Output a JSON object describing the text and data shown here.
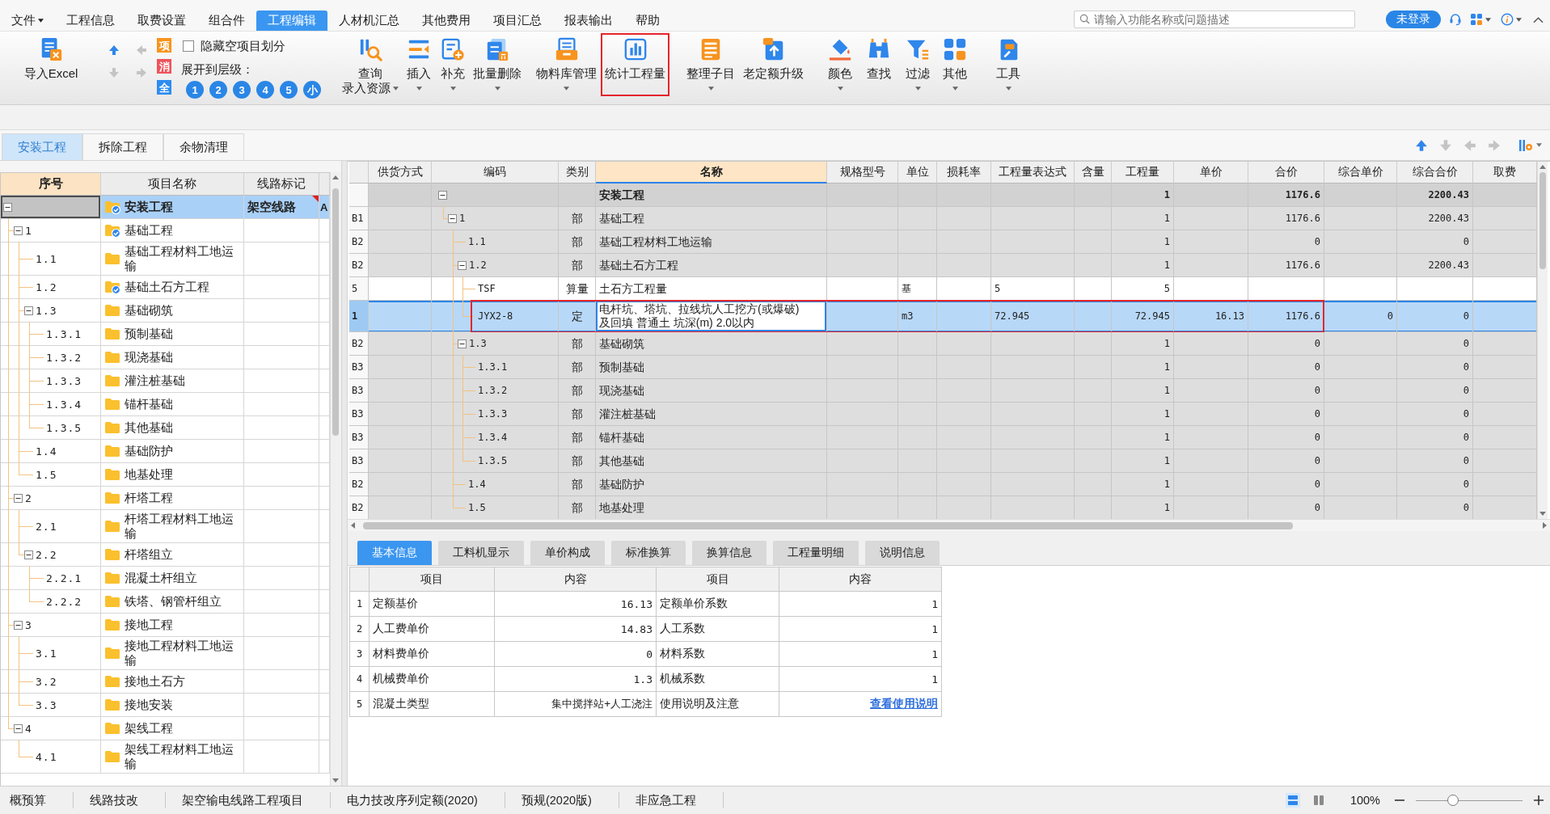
{
  "menu": {
    "items": [
      {
        "label": "文件",
        "dropdown": true,
        "selected": false
      },
      {
        "label": "工程信息",
        "dropdown": false,
        "selected": false
      },
      {
        "label": "取费设置",
        "dropdown": false,
        "selected": false
      },
      {
        "label": "组合件",
        "dropdown": false,
        "selected": false
      },
      {
        "label": "工程编辑",
        "dropdown": false,
        "selected": true
      },
      {
        "label": "人材机汇总",
        "dropdown": false,
        "selected": false
      },
      {
        "label": "其他费用",
        "dropdown": false,
        "selected": false
      },
      {
        "label": "项目汇总",
        "dropdown": false,
        "selected": false
      },
      {
        "label": "报表输出",
        "dropdown": false,
        "selected": false
      },
      {
        "label": "帮助",
        "dropdown": false,
        "selected": false
      }
    ]
  },
  "search": {
    "placeholder": "请输入功能名称或问题描述"
  },
  "account": {
    "label": "未登录"
  },
  "toolbar": {
    "import": {
      "label": "导入Excel"
    },
    "move_buttons": [
      {
        "disabled": false
      },
      {
        "disabled": true
      },
      {
        "disabled": true
      },
      {
        "disabled": true
      }
    ],
    "tiles": [
      {
        "label": "项",
        "color": "#f7941d"
      },
      {
        "label": "消",
        "color": "#f0525a"
      },
      {
        "label": "全",
        "color": "#2d8cf0"
      }
    ],
    "hide_empty": {
      "label": "隐藏空项目划分",
      "checked": false
    },
    "expand_levels": {
      "label": "展开到层级：",
      "options": [
        "1",
        "2",
        "3",
        "4",
        "5",
        "小"
      ]
    },
    "buttons": [
      {
        "label": "查询",
        "sublabel": "录入资源",
        "dropdown": true,
        "highlighted": false
      },
      {
        "label": "插入",
        "dropdown": true,
        "highlighted": false
      },
      {
        "label": "补充",
        "dropdown": true,
        "highlighted": false
      },
      {
        "label": "批量删除",
        "dropdown": true,
        "highlighted": false
      },
      {
        "label": "物料库管理",
        "dropdown": true,
        "highlighted": false
      },
      {
        "label": "统计工程量",
        "dropdown": false,
        "highlighted": true
      },
      {
        "label": "整理子目",
        "dropdown": true,
        "highlighted": false
      },
      {
        "label": "老定额升级",
        "dropdown": false,
        "highlighted": false
      },
      {
        "label": "颜色",
        "dropdown": true,
        "highlighted": false
      },
      {
        "label": "查找",
        "dropdown": false,
        "highlighted": false
      },
      {
        "label": "过滤",
        "dropdown": true,
        "highlighted": false
      },
      {
        "label": "其他",
        "dropdown": true,
        "highlighted": false
      },
      {
        "label": "工具",
        "dropdown": true,
        "highlighted": false
      }
    ]
  },
  "project_tabs": [
    {
      "label": "安装工程",
      "selected": true
    },
    {
      "label": "拆除工程",
      "selected": false
    },
    {
      "label": "余物清理",
      "selected": false
    }
  ],
  "table_nav": [
    {
      "disabled": false
    },
    {
      "disabled": true
    },
    {
      "disabled": true
    },
    {
      "disabled": true
    }
  ],
  "tree": {
    "columns": [
      {
        "label": "序号",
        "selected": true
      },
      {
        "label": "项目名称",
        "selected": false
      },
      {
        "label": "线路标记",
        "selected": false
      }
    ],
    "rows": [
      {
        "name": "安装工程",
        "route": "架空线路",
        "column_4": "A",
        "checked": true,
        "note": true,
        "selected": true,
        "expanded": true,
        "children": [
          {
            "number": "1",
            "name": "基础工程",
            "checked": true,
            "note": false,
            "selected": false,
            "expanded": true,
            "children": [
              {
                "number": "1.1",
                "name": "基础工程材料工地运输",
                "checked": false,
                "note": false,
                "selected": false
              },
              {
                "number": "1.2",
                "name": "基础土石方工程",
                "checked": true,
                "note": false,
                "selected": false
              },
              {
                "number": "1.3",
                "name": "基础砌筑",
                "checked": false,
                "note": false,
                "selected": false,
                "expanded": true,
                "children": [
                  {
                    "number": "1.3.1",
                    "name": "预制基础",
                    "checked": false,
                    "note": false,
                    "selected": false
                  },
                  {
                    "number": "1.3.2",
                    "name": "现浇基础",
                    "checked": false,
                    "note": false,
                    "selected": false
                  },
                  {
                    "number": "1.3.3",
                    "name": "灌注桩基础",
                    "checked": false,
                    "note": false,
                    "selected": false
                  },
                  {
                    "number": "1.3.4",
                    "name": "锚杆基础",
                    "checked": false,
                    "note": false,
                    "selected": false
                  },
                  {
                    "number": "1.3.5",
                    "name": "其他基础",
                    "checked": false,
                    "note": false,
                    "selected": false
                  }
                ]
              },
              {
                "number": "1.4",
                "name": "基础防护",
                "checked": false,
                "note": false,
                "selected": false
              },
              {
                "number": "1.5",
                "name": "地基处理",
                "checked": false,
                "note": false,
                "selected": false
              }
            ]
          },
          {
            "number": "2",
            "name": "杆塔工程",
            "checked": false,
            "note": false,
            "selected": false,
            "expanded": true,
            "children": [
              {
                "number": "2.1",
                "name": "杆塔工程材料工地运输",
                "checked": false,
                "note": false,
                "selected": false
              },
              {
                "number": "2.2",
                "name": "杆塔组立",
                "checked": false,
                "note": false,
                "selected": false,
                "expanded": true,
                "children": [
                  {
                    "number": "2.2.1",
                    "name": "混凝土杆组立",
                    "checked": false,
                    "note": false,
                    "selected": false
                  },
                  {
                    "number": "2.2.2",
                    "name": "铁塔、钢管杆组立",
                    "checked": false,
                    "note": false,
                    "selected": false
                  }
                ]
              }
            ]
          },
          {
            "number": "3",
            "name": "接地工程",
            "checked": false,
            "note": false,
            "selected": false,
            "expanded": true,
            "children": [
              {
                "number": "3.1",
                "name": "接地工程材料工地运输",
                "checked": false,
                "note": false,
                "selected": false
              },
              {
                "number": "3.2",
                "name": "接地土石方",
                "checked": false,
                "note": false,
                "selected": false
              },
              {
                "number": "3.3",
                "name": "接地安装",
                "checked": false,
                "note": false,
                "selected": false
              }
            ]
          },
          {
            "number": "4",
            "name": "架线工程",
            "checked": false,
            "note": false,
            "selected": false,
            "expanded": true,
            "children": [
              {
                "number": "4.1",
                "name": "架线工程材料工地运输",
                "checked": false,
                "note": false,
                "selected": false
              }
            ]
          }
        ]
      }
    ]
  },
  "table": {
    "columns": [
      {
        "label": "供货方式",
        "selected": false
      },
      {
        "label": "编码",
        "selected": false
      },
      {
        "label": "类别",
        "selected": false
      },
      {
        "label": "名称",
        "selected": true
      },
      {
        "label": "规格型号",
        "selected": false
      },
      {
        "label": "单位",
        "selected": false
      },
      {
        "label": "损耗率",
        "selected": false
      },
      {
        "label": "工程量表达式",
        "selected": false
      },
      {
        "label": "含量",
        "selected": false
      },
      {
        "label": "工程量",
        "selected": false
      },
      {
        "label": "单价",
        "selected": false
      },
      {
        "label": "合价",
        "selected": false
      },
      {
        "label": "综合单价",
        "selected": false
      },
      {
        "label": "综合合价",
        "selected": false
      },
      {
        "label": "取费",
        "selected": false
      }
    ],
    "rows": [
      {
        "kind": "total",
        "name": "安装工程",
        "quantity": "1",
        "total": "1176.6",
        "comp_total": "2200.43",
        "selected": false,
        "highlighted": false,
        "expanded": true,
        "children": [
          {
            "kind": "section",
            "row_no": "B1",
            "code": "1",
            "type": "部",
            "name": "基础工程",
            "quantity": "1",
            "total": "1176.6",
            "comp_total": "2200.43",
            "selected": false,
            "highlighted": false,
            "expanded": true,
            "children": [
              {
                "kind": "section",
                "row_no": "B2",
                "code": "1.1",
                "type": "部",
                "name": "基础工程材料工地运输",
                "quantity": "1",
                "total": "0",
                "comp_total": "0",
                "selected": false,
                "highlighted": false
              },
              {
                "kind": "section",
                "row_no": "B2",
                "code": "1.2",
                "type": "部",
                "name": "基础土石方工程",
                "quantity": "1",
                "total": "1176.6",
                "comp_total": "2200.43",
                "selected": false,
                "highlighted": false,
                "expanded": true,
                "children": [
                  {
                    "kind": "measure",
                    "row_no": "5",
                    "code": "TSF",
                    "type": "算量",
                    "name": "土石方工程量",
                    "unit": "基",
                    "expression": "5",
                    "quantity": "5",
                    "selected": false,
                    "highlighted": false
                  },
                  {
                    "kind": "item",
                    "row_no": "1",
                    "code": "JYX2-8",
                    "type": "定",
                    "name": "电杆坑、塔坑、拉线坑人工挖方(或爆破)及回填 普通土 坑深(m) 2.0以内",
                    "unit": "m3",
                    "expression": "72.945",
                    "quantity": "72.945",
                    "unit_price": "16.13",
                    "total": "1176.6",
                    "comp_unit_price": "0",
                    "comp_total": "0",
                    "selected": true,
                    "highlighted": true
                  }
                ]
              },
              {
                "kind": "section",
                "row_no": "B2",
                "code": "1.3",
                "type": "部",
                "name": "基础砌筑",
                "quantity": "1",
                "total": "0",
                "comp_total": "0",
                "selected": false,
                "highlighted": false,
                "expanded": true,
                "children": [
                  {
                    "kind": "section",
                    "row_no": "B3",
                    "code": "1.3.1",
                    "type": "部",
                    "name": "预制基础",
                    "quantity": "1",
                    "total": "0",
                    "comp_total": "0",
                    "selected": false,
                    "highlighted": false
                  },
                  {
                    "kind": "section",
                    "row_no": "B3",
                    "code": "1.3.2",
                    "type": "部",
                    "name": "现浇基础",
                    "quantity": "1",
                    "total": "0",
                    "comp_total": "0",
                    "selected": false,
                    "highlighted": false
                  },
                  {
                    "kind": "section",
                    "row_no": "B3",
                    "code": "1.3.3",
                    "type": "部",
                    "name": "灌注桩基础",
                    "quantity": "1",
                    "total": "0",
                    "comp_total": "0",
                    "selected": false,
                    "highlighted": false
                  },
                  {
                    "kind": "section",
                    "row_no": "B3",
                    "code": "1.3.4",
                    "type": "部",
                    "name": "锚杆基础",
                    "quantity": "1",
                    "total": "0",
                    "comp_total": "0",
                    "selected": false,
                    "highlighted": false
                  },
                  {
                    "kind": "section",
                    "row_no": "B3",
                    "code": "1.3.5",
                    "type": "部",
                    "name": "其他基础",
                    "quantity": "1",
                    "total": "0",
                    "comp_total": "0",
                    "selected": false,
                    "highlighted": false
                  }
                ]
              },
              {
                "kind": "section",
                "row_no": "B2",
                "code": "1.4",
                "type": "部",
                "name": "基础防护",
                "quantity": "1",
                "total": "0",
                "comp_total": "0",
                "selected": false,
                "highlighted": false
              },
              {
                "kind": "section",
                "row_no": "B2",
                "code": "1.5",
                "type": "部",
                "name": "地基处理",
                "quantity": "1",
                "total": "0",
                "comp_total": "0",
                "selected": false,
                "highlighted": false
              }
            ]
          }
        ]
      }
    ]
  },
  "detail_tabs": [
    {
      "label": "基本信息",
      "selected": true
    },
    {
      "label": "工料机显示",
      "selected": false
    },
    {
      "label": "单价构成",
      "selected": false
    },
    {
      "label": "标准换算",
      "selected": false
    },
    {
      "label": "换算信息",
      "selected": false
    },
    {
      "label": "工程量明细",
      "selected": false
    },
    {
      "label": "说明信息",
      "selected": false
    }
  ],
  "info": {
    "columns": [
      "项目",
      "内容",
      "项目",
      "内容"
    ],
    "rows": [
      {
        "no": "1",
        "cells": [
          {
            "kind": "text",
            "text": "定额基价"
          },
          {
            "kind": "text",
            "text": "16.13"
          },
          {
            "kind": "text",
            "text": "定额单价系数"
          },
          {
            "kind": "text",
            "text": "1"
          }
        ]
      },
      {
        "no": "2",
        "cells": [
          {
            "kind": "text",
            "text": "人工费单价"
          },
          {
            "kind": "text",
            "text": "14.83"
          },
          {
            "kind": "text",
            "text": "人工系数"
          },
          {
            "kind": "text",
            "text": "1"
          }
        ]
      },
      {
        "no": "3",
        "cells": [
          {
            "kind": "text",
            "text": "材料费单价"
          },
          {
            "kind": "text",
            "text": "0"
          },
          {
            "kind": "text",
            "text": "材料系数"
          },
          {
            "kind": "text",
            "text": "1"
          }
        ]
      },
      {
        "no": "4",
        "cells": [
          {
            "kind": "text",
            "text": "机械费单价"
          },
          {
            "kind": "text",
            "text": "1.3"
          },
          {
            "kind": "text",
            "text": "机械系数"
          },
          {
            "kind": "text",
            "text": "1"
          }
        ]
      },
      {
        "no": "5",
        "cells": [
          {
            "kind": "text",
            "text": "混凝土类型"
          },
          {
            "kind": "text",
            "text": "集中搅拌站+人工浇注"
          },
          {
            "kind": "text",
            "text": "使用说明及注意"
          },
          {
            "kind": "link",
            "text": "查看使用说明"
          }
        ]
      }
    ]
  },
  "status_bar": {
    "items": [
      "概预算",
      "线路技改",
      "架空输电线路工程项目",
      "电力技改序列定额(2020)",
      "预规(2020版)",
      "非应急工程"
    ],
    "views": [
      {
        "selected": true
      },
      {
        "selected": false
      }
    ],
    "zoom": {
      "reading": "100%",
      "level": 0.35
    }
  }
}
